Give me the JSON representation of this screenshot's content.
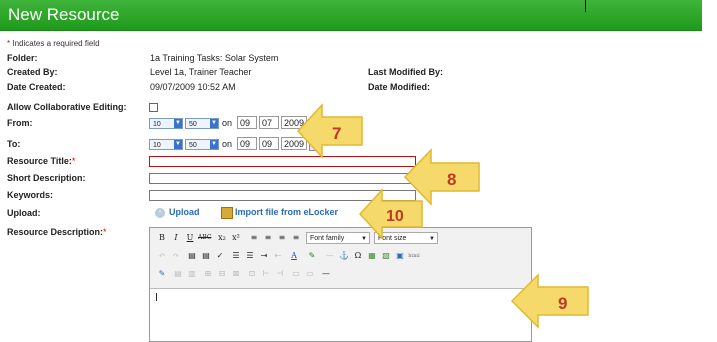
{
  "panel": {
    "title": "New Resource"
  },
  "required_note": {
    "star": "*",
    "text": "Indicates a required field"
  },
  "fields": {
    "folder": {
      "label": "Folder:",
      "value": "1a Training Tasks: Solar System"
    },
    "created_by": {
      "label": "Created By:",
      "value": "Level 1a, Trainer Teacher"
    },
    "last_modified_by": {
      "label": "Last Modified By:",
      "value": ""
    },
    "date_created": {
      "label": "Date Created:",
      "value": "09/07/2009 10:52 AM"
    },
    "date_modified": {
      "label": "Date Modified:",
      "value": ""
    },
    "collab": {
      "label": "Allow Collaborative Editing:",
      "checked": false
    },
    "from": {
      "label": "From:",
      "hour": "10",
      "minute": "50",
      "on": "on",
      "month": "09",
      "day": "07",
      "year": "2009"
    },
    "to": {
      "label": "To:",
      "hour": "10",
      "minute": "50",
      "on": "on",
      "month": "09",
      "day": "09",
      "year": "2009"
    },
    "resource_title": {
      "label": "Resource Title:",
      "required": "*",
      "value": ""
    },
    "short_description": {
      "label": "Short Description:",
      "value": ""
    },
    "keywords": {
      "label": "Keywords:",
      "value": ""
    },
    "upload": {
      "label": "Upload:",
      "upload_link": "Upload",
      "import_link": "Import file from eLocker"
    },
    "resource_description": {
      "label": "Resource Description:",
      "required": "*"
    }
  },
  "editor": {
    "font_family": "Font family",
    "font_size": "Font size",
    "row1": [
      "B",
      "I",
      "U",
      "ABC",
      "x₂",
      "x²",
      "≡",
      "≡",
      "≡",
      "≡"
    ],
    "row2": [
      "↶",
      "↷",
      "▤",
      "▤",
      "✓",
      "☰",
      "☰",
      "⇥",
      "⇤",
      "A",
      "✎",
      "—",
      "⚓",
      "Ω",
      "▦",
      "▧",
      "▣",
      "html"
    ],
    "row3": [
      "✎",
      "▤",
      "▥",
      "⊞",
      "⊟",
      "⊠",
      "⊡",
      "⊢",
      "⊣",
      "▭",
      "▭",
      "—"
    ]
  },
  "callouts": [
    "7",
    "8",
    "9",
    "10"
  ],
  "colors": {
    "title_bg": "#2aa52a",
    "callout": "#f5d96b",
    "callout_text": "#c0392b"
  }
}
